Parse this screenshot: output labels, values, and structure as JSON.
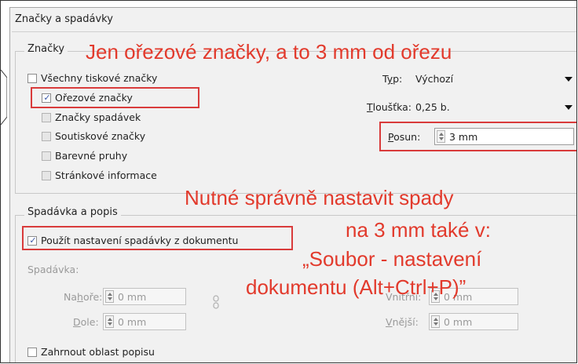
{
  "dialog": {
    "title": "Značky a spadávky"
  },
  "marks": {
    "group_label": "Značky",
    "all_printer_marks": {
      "label": "Všechny tiskové značky",
      "checked": false
    },
    "crop_marks": {
      "label": "Ořezové značky",
      "checked": true
    },
    "bleed_marks": {
      "label": "Značky spadávek",
      "checked": false
    },
    "registration_marks": {
      "label": "Soutiskové značky",
      "checked": false
    },
    "color_bars": {
      "label": "Barevné pruhy",
      "checked": false
    },
    "page_information": {
      "label": "Stránkové informace",
      "checked": false
    },
    "type_label_pre": "T",
    "type_label_u": "y",
    "type_label_post": "p:",
    "type_value": "Výchozí",
    "weight_label_u": "T",
    "weight_label_post": "loušťka:",
    "weight_value": "0,25 b.",
    "offset_label_u": "P",
    "offset_label_post": "osun:",
    "offset_value": "3 mm"
  },
  "bleed": {
    "group_label": "Spadávka a popis",
    "use_document_settings": {
      "label": "Použít nastavení spadávky z dokumentu",
      "checked": true
    },
    "bleed_label": "Spadávka:",
    "top_label_pre": "Na",
    "top_label_u": "h",
    "top_label_post": "oře:",
    "top_value": "0 mm",
    "bottom_label_u": "D",
    "bottom_label_post": "ole:",
    "bottom_value": "0 mm",
    "inside_label": "Vnitřní:",
    "inside_value": "0 mm",
    "outside_label_u": "V",
    "outside_label_post": "nější:",
    "outside_value": "0 mm",
    "include_slug": {
      "label": "Zahrnout oblast popisu",
      "checked": false
    }
  },
  "annotations": {
    "crop_note": "Jen ořezové značky, a to 3 mm od ořezu",
    "bleed_note_line1": "Nutné správně nastavit spady",
    "bleed_note_line2": "na 3 mm také v:",
    "bleed_note_line3": "„Soubor - nastavení",
    "bleed_note_line4": "dokumentu (Alt+Ctrl+P)”",
    "color": "#e23a2c"
  }
}
